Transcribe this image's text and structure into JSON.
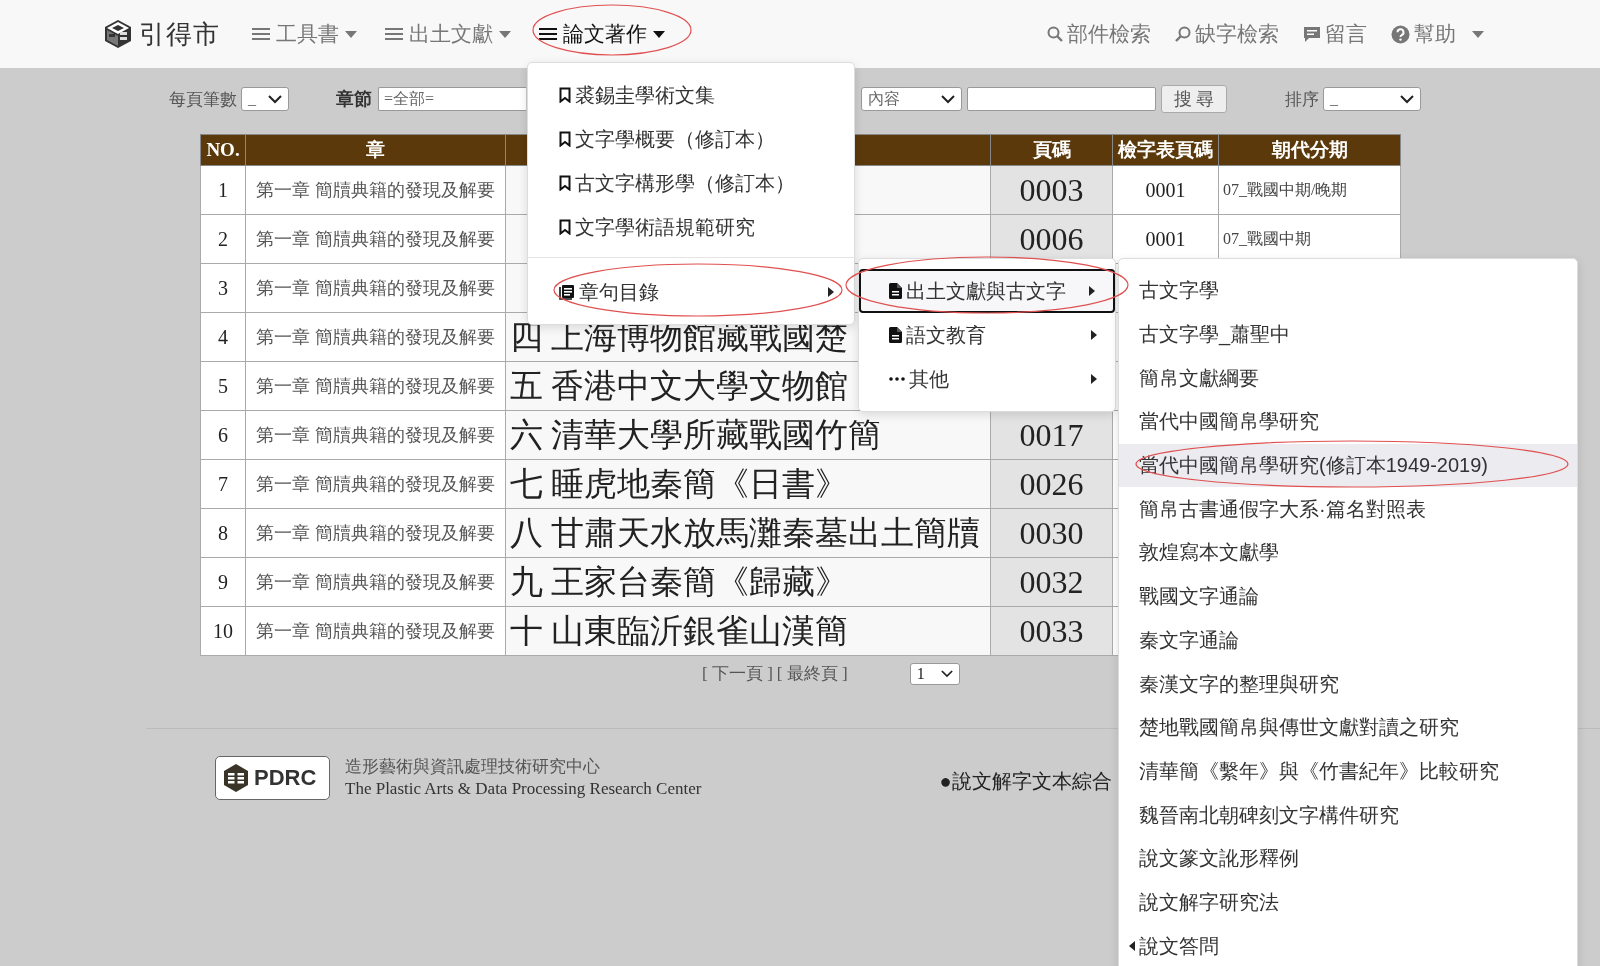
{
  "brand": {
    "name": "引得市"
  },
  "nav": [
    {
      "label": "工具書",
      "selected": false
    },
    {
      "label": "出土文獻",
      "selected": false
    },
    {
      "label": "論文著作",
      "selected": true
    }
  ],
  "nav_right": [
    {
      "kind": "search",
      "label": "部件檢索"
    },
    {
      "kind": "search-alt",
      "label": "缺字檢索"
    },
    {
      "kind": "comment",
      "label": "留言"
    },
    {
      "kind": "help",
      "label": "幫助"
    }
  ],
  "filters": {
    "per_page": {
      "label": "每頁筆數",
      "value": "_"
    },
    "chapter": {
      "label": "章節",
      "value": "=全部="
    },
    "field": {
      "value": "內容"
    },
    "search_button": "搜 尋",
    "sort": {
      "label": "排序",
      "value": "_"
    }
  },
  "table": {
    "columns": [
      "NO.",
      "章",
      "頁碼",
      "檢字表頁碼",
      "朝代分期"
    ],
    "rows": [
      {
        "no": "1",
        "chapter": "第一章 簡牘典籍的發現及解要",
        "page": "0003",
        "index_page": "0001",
        "period": "07_戰國中期/晚期"
      },
      {
        "no": "2",
        "chapter": "第一章 簡牘典籍的發現及解要",
        "page": "0006",
        "index_page": "0001",
        "period": "07_戰國中期"
      },
      {
        "no": "3",
        "chapter": "第一章 簡牘典籍的發現及解要"
      },
      {
        "no": "4",
        "chapter": "第一章 簡牘典籍的發現及解要",
        "column_3": "四 上海博物館藏戰國楚"
      },
      {
        "no": "5",
        "chapter": "第一章 簡牘典籍的發現及解要",
        "column_3": "五 香港中文大學文物館"
      },
      {
        "no": "6",
        "chapter": "第一章 簡牘典籍的發現及解要",
        "column_3": "六 清華大學所藏戰國竹簡",
        "page": "0017"
      },
      {
        "no": "7",
        "chapter": "第一章 簡牘典籍的發現及解要",
        "column_3": "七 睡虎地秦簡《日書》",
        "page": "0026"
      },
      {
        "no": "8",
        "chapter": "第一章 簡牘典籍的發現及解要",
        "column_3": "八 甘肅天水放馬灘秦墓出土簡牘",
        "page": "0030"
      },
      {
        "no": "9",
        "chapter": "第一章 簡牘典籍的發現及解要",
        "column_3": "九 王家台秦簡《歸藏》",
        "page": "0032"
      },
      {
        "no": "10",
        "chapter": "第一章 簡牘典籍的發現及解要",
        "column_3": "十 山東臨沂銀雀山漢簡",
        "page": "0033"
      }
    ]
  },
  "pagination": {
    "links": [
      "[ 下一頁 ]",
      "[ 最終頁 ]"
    ],
    "page": "1"
  },
  "footer": {
    "logo": "PDRC",
    "org_zh": "造形藝術與資訊處理技術研究中心",
    "org_en": "The Plastic Arts & Data Processing Research Center",
    "link": "●說文解字文本綜合"
  },
  "menu": {
    "items": [
      {
        "kind": "book",
        "label": "裘錫圭學術文集"
      },
      {
        "kind": "book",
        "label": "文字學概要（修訂本）"
      },
      {
        "kind": "book",
        "label": "古文字構形學（修訂本）"
      },
      {
        "kind": "book",
        "label": "文字學術語規範研究"
      },
      {
        "kind": "divider"
      },
      {
        "kind": "list",
        "label": "章句目錄"
      }
    ]
  },
  "submenu": {
    "items": [
      {
        "kind": "file",
        "label": "出土文獻與古文字",
        "selected": true
      },
      {
        "kind": "file",
        "label": "語文教育",
        "selected": false
      },
      {
        "kind": "more",
        "label": "其他",
        "selected": false
      }
    ]
  },
  "submenu_2": {
    "items": [
      {
        "kind": "plain",
        "label": "古文字學",
        "selected": false
      },
      {
        "kind": "plain",
        "label": "古文字學_蕭聖中",
        "selected": false
      },
      {
        "kind": "plain",
        "label": "簡帛文獻綱要",
        "selected": false
      },
      {
        "kind": "plain",
        "label": "當代中國簡帛學研究",
        "selected": false
      },
      {
        "kind": "plain",
        "label": "當代中國簡帛學研究(修訂本1949-2019)",
        "selected": true
      },
      {
        "kind": "plain",
        "label": "簡帛古書通假字大系·篇名對照表",
        "selected": false
      },
      {
        "kind": "plain",
        "label": "敦煌寫本文獻學",
        "selected": false
      },
      {
        "kind": "plain",
        "label": "戰國文字通論",
        "selected": false
      },
      {
        "kind": "plain",
        "label": "秦文字通論",
        "selected": false
      },
      {
        "kind": "plain",
        "label": "秦漢文字的整理與研究",
        "selected": false
      },
      {
        "kind": "plain",
        "label": "楚地戰國簡帛與傳世文獻對讀之研究",
        "selected": false
      },
      {
        "kind": "plain",
        "label": "清華簡《繫年》與《竹書紀年》比較研究",
        "selected": false
      },
      {
        "kind": "plain",
        "label": "魏晉南北朝碑刻文字構件研究",
        "selected": false
      },
      {
        "kind": "plain",
        "label": "說文篆文訛形釋例",
        "selected": false
      },
      {
        "kind": "plain",
        "label": "說文解字研究法",
        "selected": false
      },
      {
        "kind": "back",
        "label": "說文答問",
        "selected": false
      }
    ]
  }
}
